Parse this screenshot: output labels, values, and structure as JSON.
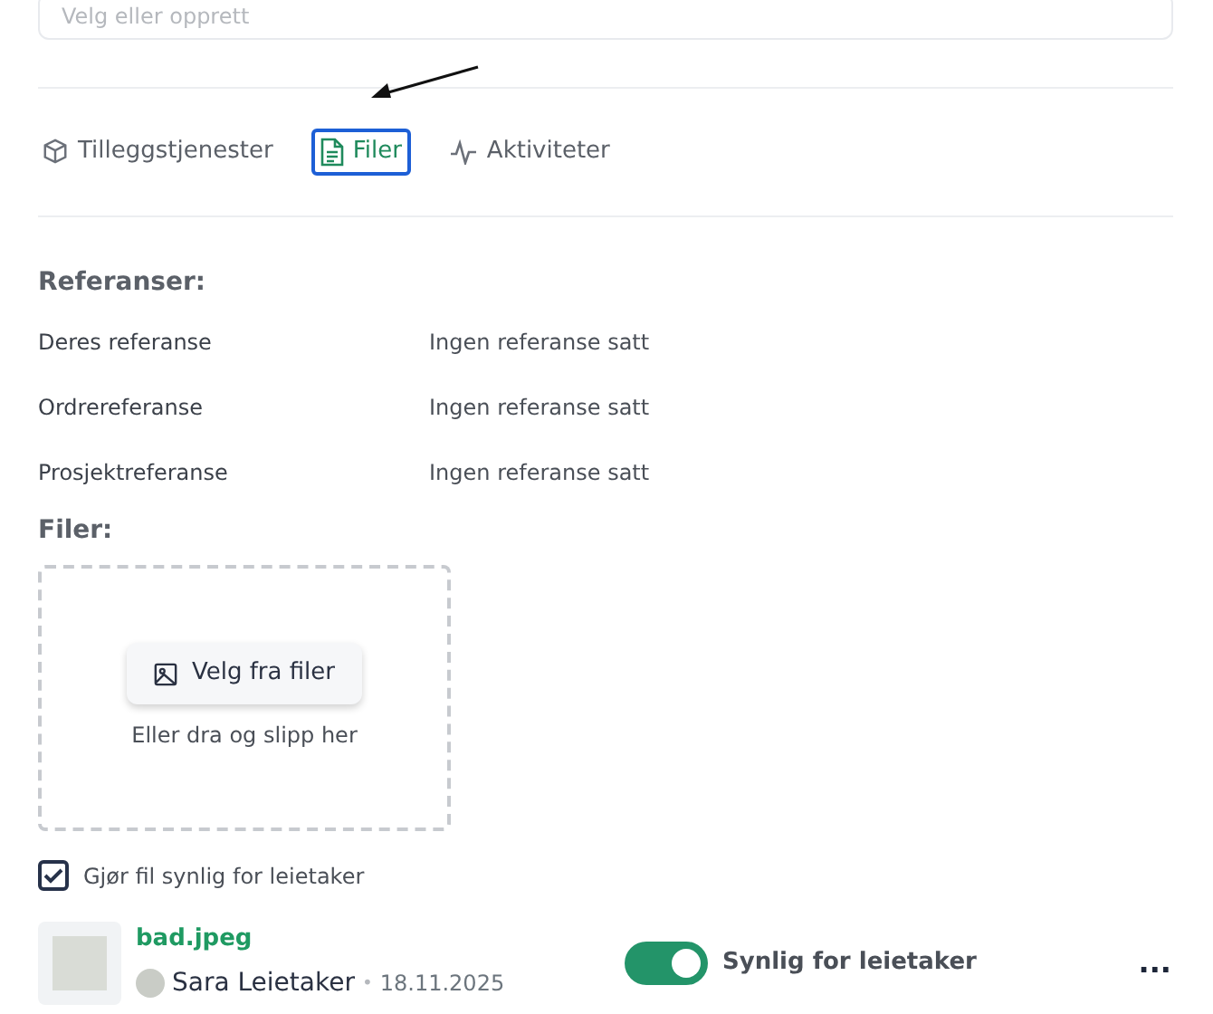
{
  "top_field": {
    "placeholder": "Velg eller opprett"
  },
  "tabs": [
    {
      "kind": "box",
      "label": "Tilleggstjenester",
      "selected": false
    },
    {
      "kind": "file",
      "label": "Filer",
      "selected": true
    },
    {
      "kind": "pulse",
      "label": "Aktiviteter",
      "selected": false
    }
  ],
  "references": {
    "heading": "Referanser:",
    "rows": [
      {
        "label": "Deres referanse",
        "value": "Ingen referanse satt"
      },
      {
        "label": "Ordrereferanse",
        "value": "Ingen referanse satt"
      },
      {
        "label": "Prosjektreferanse",
        "value": "Ingen referanse satt"
      }
    ]
  },
  "files": {
    "heading": "Filer:",
    "dropzone": {
      "button": "Velg fra filer",
      "hint": "Eller dra og slipp her"
    },
    "visible_checkbox": {
      "label": "Gjør fil synlig for leietaker",
      "checked": true
    },
    "items": [
      {
        "name": "bad.jpeg",
        "author": "Sara Leietaker",
        "separator": "•",
        "date": "18.11.2025",
        "visible": true,
        "visible_label": "Synlig for leietaker",
        "menu": "..."
      }
    ]
  }
}
